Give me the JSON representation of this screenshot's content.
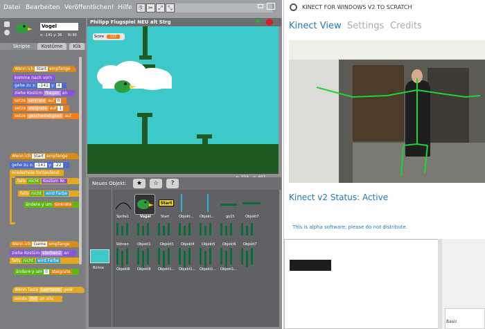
{
  "scratch": {
    "menu": [
      "Datei",
      "Bearbeiten",
      "Veröffentlichen!",
      "Hilfe"
    ],
    "sprite": {
      "name": "Vogel",
      "coords": "x: -141  y: 36",
      "direction": "Ri 90"
    },
    "tabs": [
      "Skripte",
      "Kostüme",
      "Klä"
    ],
    "scripts": [
      [
        "Wenn ich",
        "Start",
        "empfange"
      ],
      [
        "komme nach vorn"
      ],
      [
        "gehe zu x:",
        "-141",
        "y:",
        "4"
      ],
      [
        "ziehe Kostüm",
        "fliegen",
        "an"
      ],
      [
        "setze",
        "sinkrate",
        "auf",
        "0"
      ],
      [
        "setze",
        "steigrate",
        "auf",
        "1"
      ],
      [
        "setze",
        "geschwindigkeit",
        "auf"
      ],
      [
        "Wenn ich",
        "Start",
        "empfange"
      ],
      [
        "gehe zu x:",
        "-141",
        "y:",
        "-22"
      ],
      [
        "wiederhole fortlaufend"
      ],
      [
        "falls",
        "nicht",
        "Kostüm Nr."
      ],
      [
        "falls",
        "nicht",
        "wird Farbe"
      ],
      [
        "ändere y um",
        "sinkrate"
      ],
      [
        "Wenn ich",
        "Game",
        "empfange"
      ],
      [
        "ziehe Kostüm",
        "sterben2",
        "an"
      ],
      [
        "falls",
        "nicht",
        "wird Farbe"
      ],
      [
        "ändere y um",
        "0",
        "steigrate"
      ],
      [
        "Wenn Taste",
        "Leertaste",
        "gedr"
      ],
      [
        "sende",
        "Tod",
        "an alle"
      ]
    ],
    "stage_title": "Philipp Flugspiel NEU alt Strg",
    "score_label": "Score",
    "score_value": "122",
    "coords_x": "x: 223",
    "coords_y": "y: 407",
    "new_object_label": "Neues Objekt:",
    "stage_label": "Bühne",
    "sprites": [
      "Sprite1",
      "Vogel",
      "Start",
      "Objekt...",
      "Objekt...",
      "go15",
      "Objekt7",
      "Röhren",
      "Objekt1",
      "Objekt3",
      "Objekt4",
      "Objekt5",
      "Objekt6",
      "Objekt7",
      "Objekt8",
      "Objekt9",
      "Objekt1...",
      "Objekt1...",
      "Objekt1...",
      "Objekt1..."
    ],
    "start_label": "Start"
  },
  "kinect": {
    "title": "KINECT FOR WINDOWS V2 TO SCRATCH",
    "nav": [
      "Kinect View",
      "Settings",
      "Credits"
    ],
    "status": "Kinect v2 Status: Active",
    "alpha_note": "This is alpha software, please do not distribute.",
    "basic_label": "Basic",
    "colors": {
      "accent": "#1f78b4",
      "skeleton": "#1fd43a"
    }
  }
}
